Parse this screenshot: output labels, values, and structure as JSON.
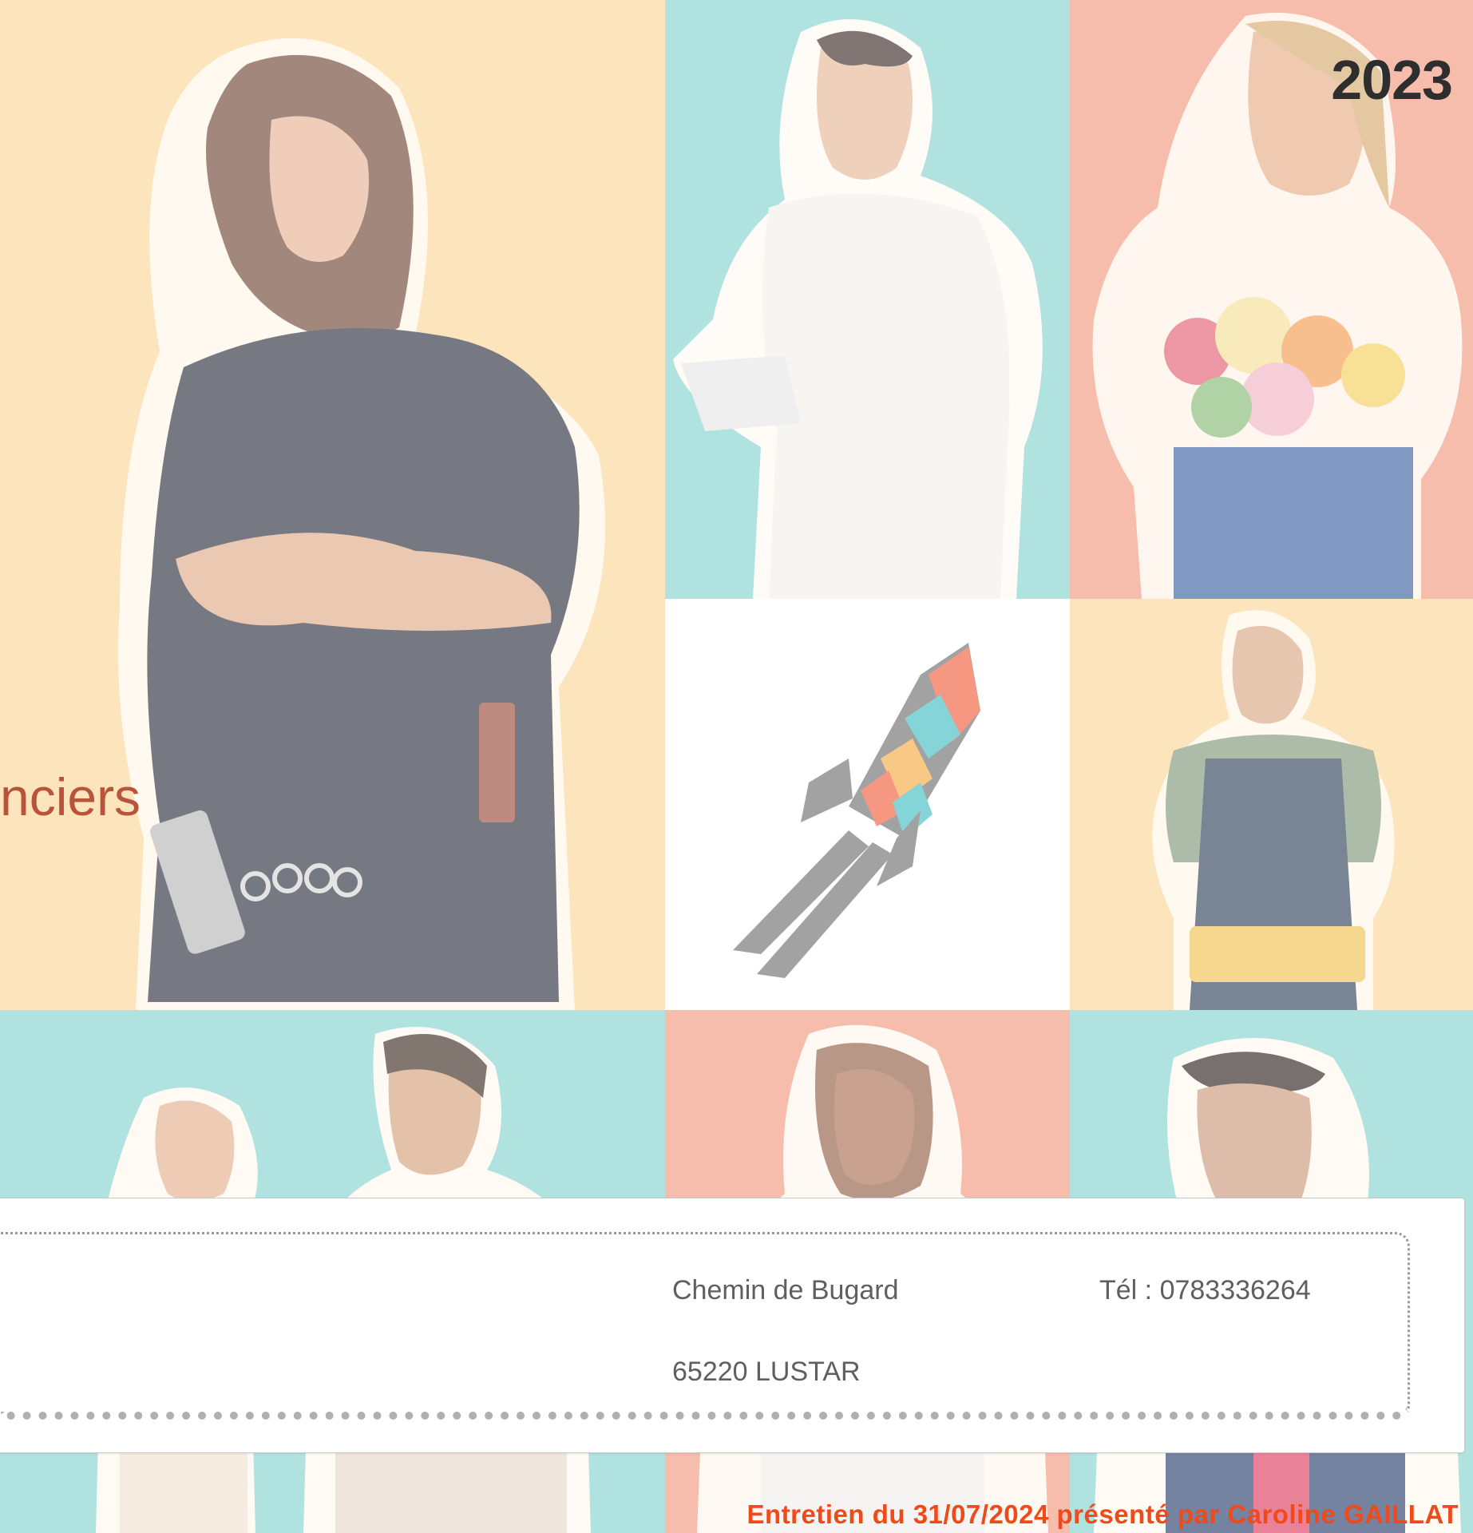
{
  "cover": {
    "year": "2023",
    "partial_word": "nciers",
    "colors": {
      "yellow": "#fbd9a0",
      "teal": "#8fd6d1",
      "salmon": "#f39f88",
      "white": "#ffffff",
      "footer": "#f04a1b"
    },
    "tiles": [
      {
        "name": "tile-hairdresser",
        "color": "yellow",
        "icon": "hairdresser-person-icon"
      },
      {
        "name": "tile-nurse",
        "color": "teal",
        "icon": "nurse-person-icon"
      },
      {
        "name": "tile-florist",
        "color": "salmon",
        "icon": "florist-person-icon"
      },
      {
        "name": "tile-rocket",
        "color": "white",
        "icon": "rocket-icon"
      },
      {
        "name": "tile-craftsman",
        "color": "yellow",
        "icon": "craftsman-person-icon"
      },
      {
        "name": "tile-couple",
        "color": "teal",
        "icon": "couple-person-icon"
      },
      {
        "name": "tile-woman",
        "color": "salmon",
        "icon": "woman-person-icon"
      },
      {
        "name": "tile-man",
        "color": "teal",
        "icon": "man-person-icon"
      }
    ]
  },
  "contact": {
    "address_line1": "Chemin de Bugard",
    "address_line2": "65220 LUSTAR",
    "phone": "Tél : 0783336264"
  },
  "footer": {
    "text": "Entretien du 31/07/2024 présenté par Caroline GAILLAT"
  }
}
